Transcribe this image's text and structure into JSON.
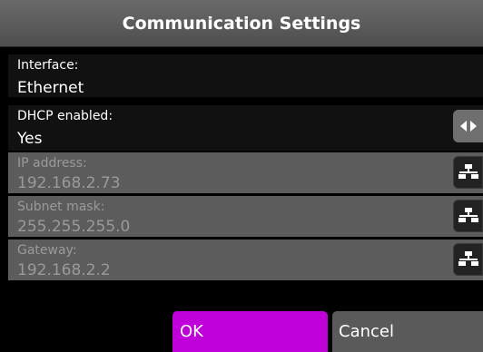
{
  "header": {
    "title": "Communication Settings"
  },
  "fields": [
    {
      "label": "Interface:",
      "value": "Ethernet"
    },
    {
      "label": "DHCP enabled:",
      "value": "Yes",
      "action_icon": "left-right-arrows-icon"
    },
    {
      "label": "IP address:",
      "value": "192.168.2.73",
      "action_icon": "network-icon"
    },
    {
      "label": "Subnet mask:",
      "value": "255.255.255.0",
      "action_icon": "network-icon"
    },
    {
      "label": "Gateway:",
      "value": "192.168.2.2",
      "action_icon": "network-icon"
    }
  ],
  "buttons": {
    "ok_label": "OK",
    "cancel_label": "Cancel"
  },
  "colors": {
    "accent_ok": "#c000d8",
    "disabled_row": "#5c5c5c",
    "disabled_text": "#9a9a9a"
  }
}
